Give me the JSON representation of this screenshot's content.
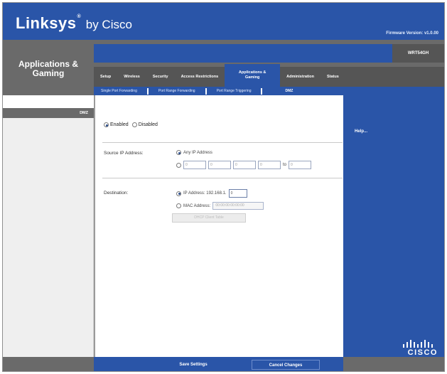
{
  "header": {
    "brand": "Linksys",
    "brand_suffix": "by Cisco",
    "firmware": "Firmware Version: v1.0.00"
  },
  "section_title": "Applications & Gaming",
  "model_name": "WRT54GH",
  "tabs": [
    {
      "label": "Setup"
    },
    {
      "label": "Wireless"
    },
    {
      "label": "Security"
    },
    {
      "label": "Access Restrictions"
    },
    {
      "label": "Applications & Gaming",
      "active": true
    },
    {
      "label": "Administration"
    },
    {
      "label": "Status"
    }
  ],
  "subtabs": [
    {
      "label": "Single Port Forwarding"
    },
    {
      "label": "Port Range Forwarding"
    },
    {
      "label": "Port Range Triggering"
    },
    {
      "label": "DMZ",
      "active": true
    }
  ],
  "left_label": "DMZ",
  "dmz": {
    "enabled_label": "Enabled",
    "disabled_label": "Disabled",
    "enabled": true,
    "source_label": "Source IP Address:",
    "source_any_label": "Any IP Address",
    "source_range_fields": [
      "0",
      "0",
      "0",
      "0",
      "0"
    ],
    "source_to_label": "to",
    "destination_label": "Destination:",
    "dest_ip_label": "IP Address: 192.168.1.",
    "dest_ip_value": "0",
    "dest_mac_label": "MAC Address:",
    "dest_mac_value": "00:00:00:00:00:00",
    "dhcp_button": "DHCP Client Table"
  },
  "help_link": "Help...",
  "buttons": {
    "save": "Save Settings",
    "cancel": "Cancel Changes"
  },
  "cisco_word": "CISCO",
  "colors": {
    "brand_blue": "#2a55a8",
    "dark_grey": "#6a6a6a"
  }
}
